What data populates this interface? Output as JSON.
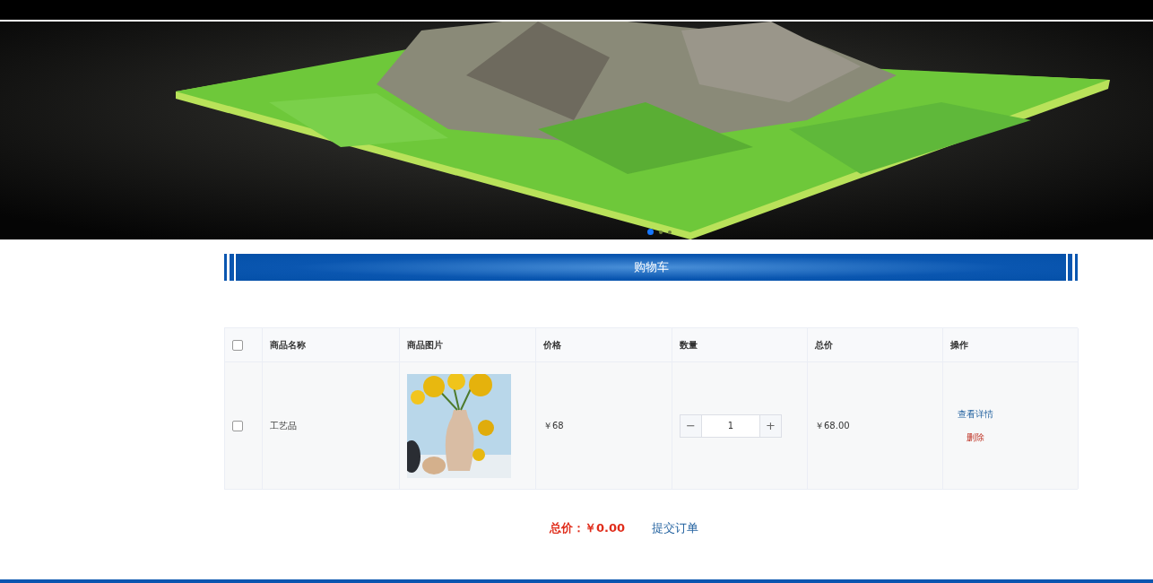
{
  "banner": {
    "kind": "picture",
    "dots": [
      {
        "selected": true
      },
      {
        "selected": false
      },
      {
        "selected": false
      }
    ]
  },
  "section_title": "购物车",
  "cart_table": {
    "select_all": {
      "checked": false
    },
    "columns": [
      "商品名称",
      "商品图片",
      "价格",
      "数量",
      "总价",
      "操作"
    ],
    "rows": [
      {
        "checked": false,
        "name": "工艺品",
        "image": {
          "kind": "picture"
        },
        "price": "￥68",
        "quantity": "1",
        "quantity_minus": "−",
        "quantity_plus": "+",
        "total": "￥68.00",
        "actions": [
          {
            "kind": "link",
            "label": "查看详情"
          },
          {
            "kind": "danger",
            "label": "删除"
          }
        ]
      }
    ]
  },
  "summary": {
    "label": "总价：",
    "value": "￥0.00",
    "submit": "提交订单"
  }
}
